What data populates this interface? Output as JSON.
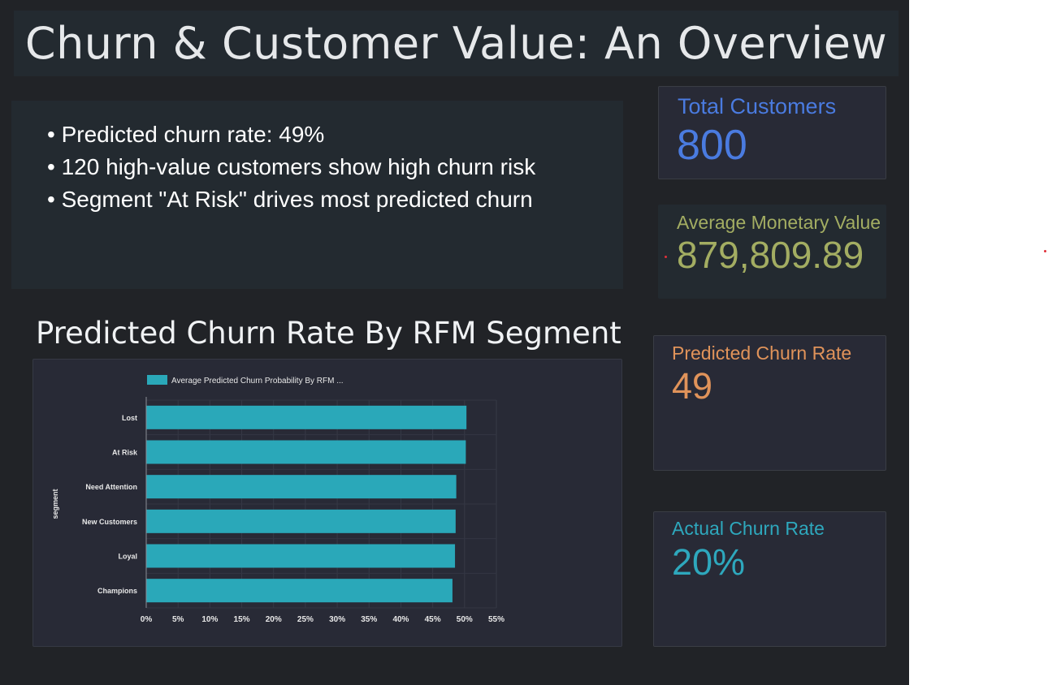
{
  "header": {
    "title": "Churn & Customer Value: An Overview"
  },
  "summary": {
    "bullets": [
      "• Predicted churn rate: 49%",
      "• 120 high-value customers show high churn risk",
      "• Segment \"At Risk\" drives most predicted churn"
    ]
  },
  "kpis": {
    "total_customers": {
      "label": "Total Customers",
      "value": "800",
      "color": "#4a7be0"
    },
    "avg_monetary": {
      "label": "Average Monetary Value",
      "value": "879,809.89",
      "color": "#a3ad62"
    },
    "predicted_churn": {
      "label": "Predicted Churn Rate",
      "value": "49",
      "color": "#e0935a"
    },
    "actual_churn": {
      "label": "Actual Churn Rate",
      "value": "20%",
      "color": "#2ea8bd"
    }
  },
  "chart": {
    "title": "Predicted Churn Rate By RFM Segment"
  },
  "chart_data": {
    "type": "bar",
    "orientation": "horizontal",
    "title": "Predicted Churn Rate By RFM Segment",
    "ylabel": "segment",
    "xlabel": "",
    "categories": [
      "Lost",
      "At Risk",
      "Need Attention",
      "New Customers",
      "Loyal",
      "Champions"
    ],
    "series": [
      {
        "name": "Average Predicted Churn Probability By RFM ...",
        "values": [
          50.3,
          50.2,
          48.7,
          48.6,
          48.5,
          48.1
        ],
        "color": "#2aa8b9"
      }
    ],
    "xlim": [
      0,
      55
    ],
    "xticks": [
      "0%",
      "5%",
      "10%",
      "15%",
      "20%",
      "25%",
      "30%",
      "35%",
      "40%",
      "45%",
      "50%",
      "55%"
    ],
    "legend": "top-left",
    "grid": true
  }
}
